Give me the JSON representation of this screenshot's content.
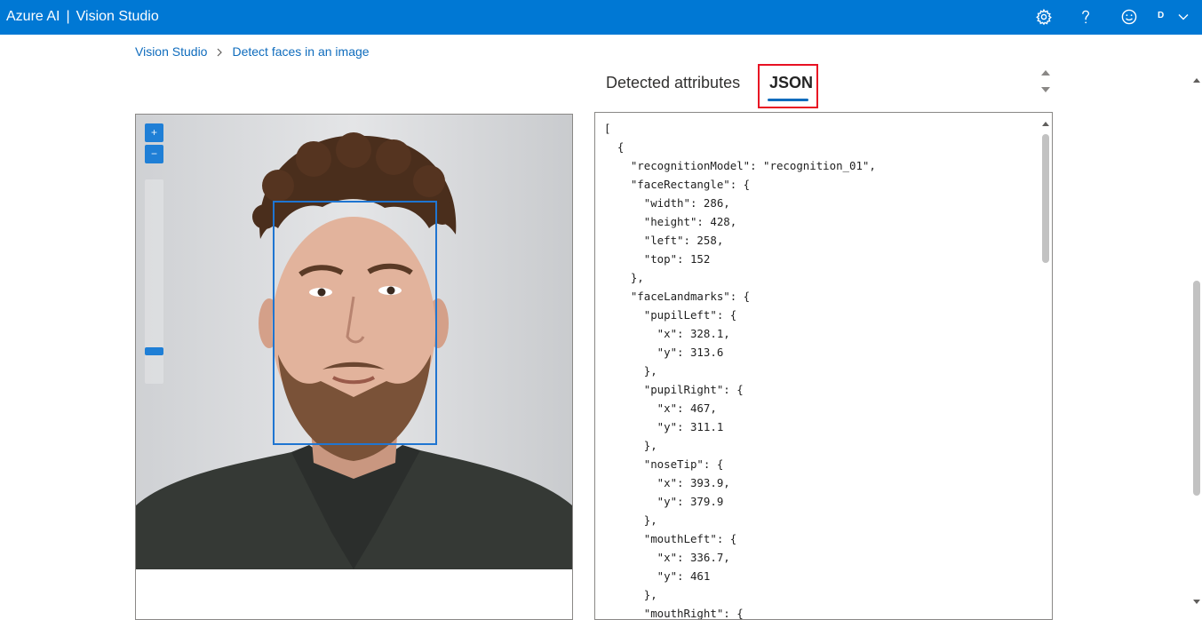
{
  "header": {
    "brand": "Azure AI",
    "separator": "|",
    "product": "Vision Studio",
    "avatar_initial": "D",
    "icons": [
      "gear-icon",
      "help-icon",
      "feedback-smiley-icon",
      "chevron-down-icon"
    ],
    "bar_color": "#0078d4"
  },
  "breadcrumb": {
    "items": [
      "Vision Studio",
      "Detect faces in an image"
    ]
  },
  "tabs": {
    "items": [
      "Detected attributes",
      "JSON"
    ],
    "selected": "JSON",
    "highlight_color": "#e81123"
  },
  "image_panel": {
    "zoom_in_label": "+",
    "zoom_out_label": "−",
    "zoom_level": 0.15,
    "box_color": "#1f75d1"
  },
  "json_output": {
    "lines": [
      "[",
      "  {",
      "    \"recognitionModel\": \"recognition_01\",",
      "    \"faceRectangle\": {",
      "      \"width\": 286,",
      "      \"height\": 428,",
      "      \"left\": 258,",
      "      \"top\": 152",
      "    },",
      "    \"faceLandmarks\": {",
      "      \"pupilLeft\": {",
      "        \"x\": 328.1,",
      "        \"y\": 313.6",
      "      },",
      "      \"pupilRight\": {",
      "        \"x\": 467,",
      "        \"y\": 311.1",
      "      },",
      "      \"noseTip\": {",
      "        \"x\": 393.9,",
      "        \"y\": 379.9",
      "      },",
      "      \"mouthLeft\": {",
      "        \"x\": 336.7,",
      "        \"y\": 461",
      "      },",
      "      \"mouthRight\": {"
    ]
  }
}
